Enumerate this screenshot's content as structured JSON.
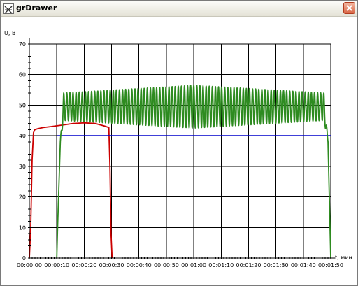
{
  "window": {
    "title": "grDrawer"
  },
  "icons": {
    "app": "chart-app-icon",
    "close": "close-icon"
  },
  "chart_data": {
    "type": "line",
    "ylabel": "U, B",
    "xlabel": "t, мин",
    "ylim": [
      0,
      70
    ],
    "xlim_seconds": [
      0,
      110
    ],
    "y_ticks": [
      0,
      10,
      20,
      30,
      40,
      50,
      60,
      70
    ],
    "x_tick_labels": [
      "00:00:00",
      "00:00:10",
      "00:00:20",
      "00:00:30",
      "00:00:40",
      "00:00:50",
      "00:01:00",
      "00:01:10",
      "00:01:20",
      "00:01:30",
      "00:01:40",
      "00:01:50"
    ],
    "grid": true,
    "colors": {
      "red": "#cc0000",
      "green": "#2e8b20",
      "blue": "#0000cc",
      "grid": "#000000"
    },
    "series": [
      {
        "color": "#cc0000",
        "x": [
          0,
          0.5,
          1,
          1.5,
          2,
          3,
          5,
          8,
          12,
          16,
          20,
          24,
          27,
          28,
          29,
          29.4,
          29.8,
          30.2
        ],
        "y": [
          0,
          10,
          32,
          41,
          42,
          42.3,
          42.7,
          43,
          43.5,
          44,
          44.2,
          44,
          43.3,
          43,
          42.7,
          30,
          8,
          0
        ]
      },
      {
        "color": "#0000cc",
        "x": [
          10,
          110
        ],
        "y": [
          40,
          40
        ]
      },
      {
        "color": "#2e8b20",
        "oscillating": true,
        "x_start": 10,
        "x_end": 110,
        "rise_end": 12.5,
        "fall_start": 107.5,
        "baseline": 49.5,
        "amplitude_start": 4.5,
        "amplitude_mid": 7.0,
        "amplitude_end": 4.5,
        "period_seconds": 1.13
      }
    ]
  }
}
